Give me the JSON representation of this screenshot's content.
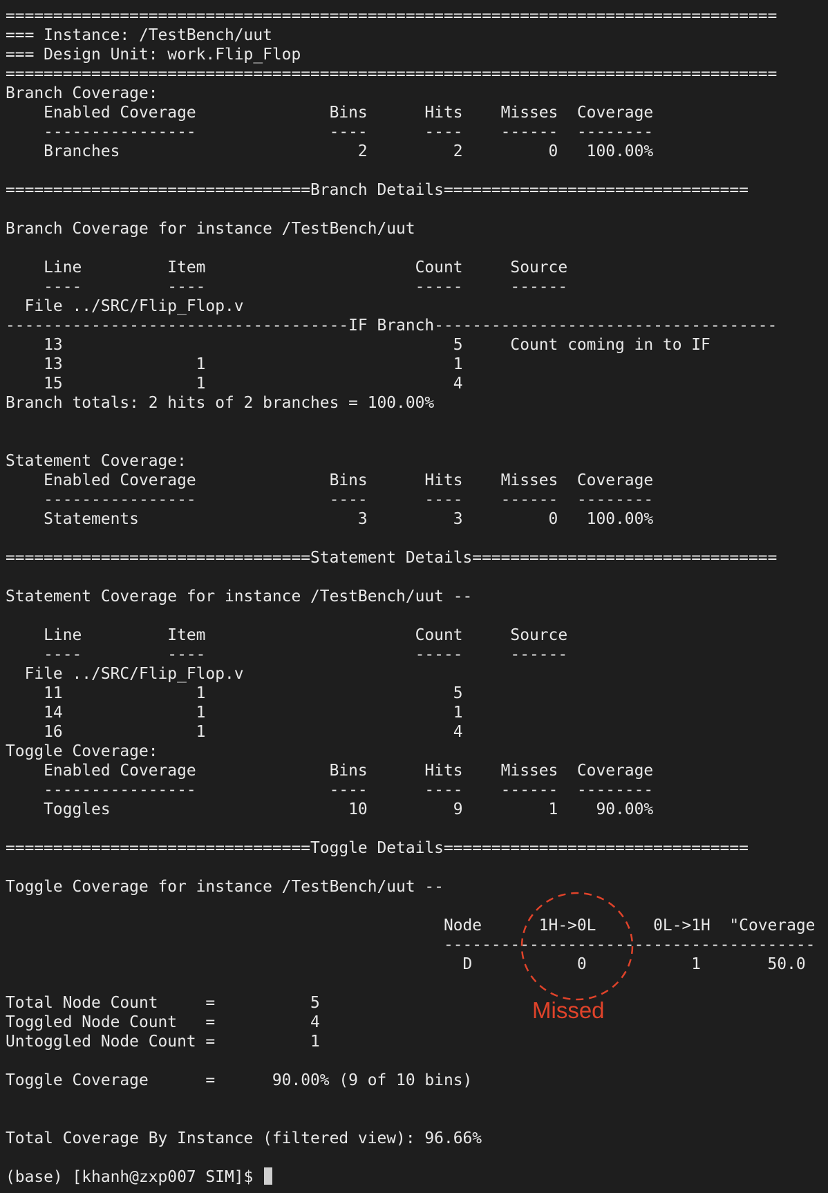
{
  "terminal": {
    "lines": [
      "=================================================================================",
      "=== Instance: /TestBench/uut",
      "=== Design Unit: work.Flip_Flop",
      "=================================================================================",
      "Branch Coverage:",
      "    Enabled Coverage              Bins      Hits    Misses  Coverage",
      "    ----------------              ----      ----    ------  --------",
      "    Branches                         2         2         0   100.00%",
      "",
      "================================Branch Details================================",
      "",
      "Branch Coverage for instance /TestBench/uut",
      "",
      "    Line         Item                      Count     Source",
      "    ----         ----                      -----     ------",
      "  File ../SRC/Flip_Flop.v",
      "------------------------------------IF Branch------------------------------------",
      "    13                                         5     Count coming in to IF",
      "    13              1                          1",
      "    15              1                          4",
      "Branch totals: 2 hits of 2 branches = 100.00%",
      "",
      "",
      "Statement Coverage:",
      "    Enabled Coverage              Bins      Hits    Misses  Coverage",
      "    ----------------              ----      ----    ------  --------",
      "    Statements                       3         3         0   100.00%",
      "",
      "================================Statement Details================================",
      "",
      "Statement Coverage for instance /TestBench/uut --",
      "",
      "    Line         Item                      Count     Source",
      "    ----         ----                      -----     ------",
      "  File ../SRC/Flip_Flop.v",
      "    11              1                          5",
      "    14              1                          1",
      "    16              1                          4",
      "Toggle Coverage:",
      "    Enabled Coverage              Bins      Hits    Misses  Coverage",
      "    ----------------              ----      ----    ------  --------",
      "    Toggles                         10         9         1    90.00%",
      "",
      "================================Toggle Details================================",
      "",
      "Toggle Coverage for instance /TestBench/uut --",
      "",
      "                                              Node      1H->0L      0L->1H  \"Coverage",
      "                                              ---------------------------------------",
      "                                                D           0           1       50.0",
      "",
      "Total Node Count     =          5",
      "Toggled Node Count   =          4",
      "Untoggled Node Count =          1",
      "",
      "Toggle Coverage      =      90.00% (9 of 10 bins)",
      "",
      "",
      "Total Coverage By Instance (filtered view): 96.66%",
      "",
      "(base) [khanh@zxp007 SIM]$ "
    ]
  },
  "annotation": {
    "label": "Missed",
    "color": "#e0432a"
  },
  "icons": {
    "cursor": "block-cursor-icon"
  }
}
